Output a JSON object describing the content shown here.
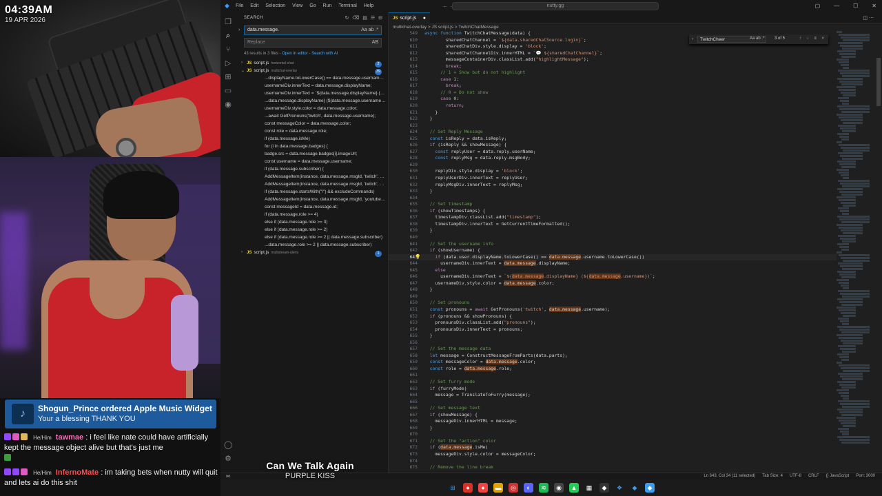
{
  "overlay": {
    "clock_time": "04:39AM",
    "clock_date": "19 APR 2026",
    "alert": {
      "title": "Shogun_Prince ordered Apple Music Widget",
      "subtitle": "Your a blessing THANK YOU"
    },
    "chat": [
      {
        "pronoun": "He/Him",
        "user": "tawmae",
        "text": ": i feel like nate could have artificially kept the message object alive but that's just me"
      },
      {
        "pronoun": "He/Him",
        "user": "InfernoMate",
        "text": ": im taking bets when nutty will quit and lets ai do this shit"
      }
    ],
    "now_playing": {
      "title": "Can We Talk Again",
      "artist": "PURPLE KISS"
    }
  },
  "vscode": {
    "menu": [
      "File",
      "Edit",
      "Selection",
      "View",
      "Go",
      "Run",
      "Terminal",
      "Help"
    ],
    "command_center": "nutty.gg",
    "sidebar": {
      "header": "SEARCH",
      "search_value": "data.message.",
      "search_opts": "Aa ab .*",
      "replace_placeholder": "Replace",
      "replace_opts": "AB",
      "results_count": "43 results in 3 files - ",
      "open_in_editor": "Open in editor",
      "search_ai": "Search with AI",
      "files": [
        {
          "name": "script.js",
          "path": "horizontal-chat",
          "count": "2"
        },
        {
          "name": "script.js",
          "path": "multichat-overlay",
          "count": "39"
        },
        {
          "name": "script.js",
          "path": "multistream-alerts",
          "count": "1"
        }
      ],
      "matches": [
        "...displayName.toLowerCase() == data.message.username.toLowerC...",
        "usernameDiv.innerText = data.message.displayName;",
        "usernameDiv.innerText = `${data.message.displayName} (${data.me...",
        "...data.message.displayName} (${data.message.username})`;",
        "usernameDiv.style.color = data.message.color;",
        "...await GetPronouns('twitch', data.message.username);",
        "const messageColor = data.message.color;",
        "const role = data.message.role;",
        "if (data.message.isMe)",
        "for (i in data.message.badges) {",
        "badge.src = data.message.badges[i].imageUrl;",
        "const username = data.message.username;",
        "if (data.message.subscriber) {",
        "AddMessageItem(instance, data.message.msgId, 'twitch', data.user.i...",
        "AddMessageItem(instance, data.message.msgId, 'twitch', data.user.i...",
        "if (data.message.startsWith(\"!\") && excludeCommands)",
        "AddMessageItem(instance, data.message.msgId, 'youtube', data.use...",
        "const messageId = data.message.id;",
        "if (data.message.role >= 4)",
        "else if (data.message.role >= 3)",
        "else if (data.message.role >= 2)",
        "else if (data.message.role >= 2 || data.message.subscriber)",
        "...data.message.role >= 2 || data.message.subscriber)"
      ]
    },
    "tab": {
      "name": "script.js"
    },
    "breadcrumb": "multichat-overlay > JS script.js > TwitchChatMessage",
    "find": {
      "value": "TwitchCheer",
      "opts": "Aa ab .*",
      "count": "3 of 5",
      "btns": "↑ ↓ ≡ ×"
    },
    "code": [
      {
        "n": "549",
        "t": "async function TwitchChatMessage(data) {"
      },
      {
        "n": "610",
        "t": "        sharedChatChannel = `${data.sharedChatSource.login}`;"
      },
      {
        "n": "611",
        "t": "        sharedChatDiv.style.display = 'block';"
      },
      {
        "n": "612",
        "t": "        sharedChatChannelDiv.innerHTML = `💬 ${sharedChatChannel}`;"
      },
      {
        "n": "613",
        "t": "        messageContainerDiv.classList.add(\"highlightMessage\");"
      },
      {
        "n": "614",
        "t": "        break;"
      },
      {
        "n": "615",
        "t": "      // 1 = Show but do not highlight"
      },
      {
        "n": "616",
        "t": "      case 1:"
      },
      {
        "n": "617",
        "t": "        break;"
      },
      {
        "n": "618",
        "t": "      // 0 = Do not show"
      },
      {
        "n": "619",
        "t": "      case 0:"
      },
      {
        "n": "620",
        "t": "        return;"
      },
      {
        "n": "621",
        "t": "    }"
      },
      {
        "n": "622",
        "t": "  }"
      },
      {
        "n": "623",
        "t": ""
      },
      {
        "n": "624",
        "t": "  // Set Reply Message"
      },
      {
        "n": "625",
        "t": "  const isReply = data.isReply;"
      },
      {
        "n": "626",
        "t": "  if (isReply && showMessage) {"
      },
      {
        "n": "627",
        "t": "    const replyUser = data.reply.userName;"
      },
      {
        "n": "628",
        "t": "    const replyMsg = data.reply.msgBody;"
      },
      {
        "n": "629",
        "t": ""
      },
      {
        "n": "630",
        "t": "    replyDiv.style.display = 'block';"
      },
      {
        "n": "631",
        "t": "    replyUserDiv.innerText = replyUser;"
      },
      {
        "n": "632",
        "t": "    replyMsgDiv.innerText = replyMsg;"
      },
      {
        "n": "633",
        "t": "  }"
      },
      {
        "n": "634",
        "t": ""
      },
      {
        "n": "635",
        "t": "  // Set timestamp"
      },
      {
        "n": "636",
        "t": "  if (showTimestamps) {"
      },
      {
        "n": "637",
        "t": "    timestampDiv.classList.add(\"timestamp\");"
      },
      {
        "n": "638",
        "t": "    timestampDiv.innerText = GetCurrentTimeFormatted();"
      },
      {
        "n": "639",
        "t": "  }"
      },
      {
        "n": "640",
        "t": ""
      },
      {
        "n": "641",
        "t": "  // Set the username info"
      },
      {
        "n": "642",
        "t": "  if (showUsername) {"
      },
      {
        "n": "643",
        "t": "    if (data.user.displayName.toLowerCase() == data.message.username.toLowerCase())"
      },
      {
        "n": "644",
        "t": "      usernameDiv.innerText = data.message.displayName;"
      },
      {
        "n": "645",
        "t": "    else"
      },
      {
        "n": "646",
        "t": "      usernameDiv.innerText = `${data.message.displayName} (${data.message.username})`;"
      },
      {
        "n": "647",
        "t": "    usernameDiv.style.color = data.message.color;"
      },
      {
        "n": "648",
        "t": "  }"
      },
      {
        "n": "649",
        "t": ""
      },
      {
        "n": "650",
        "t": "  // Set pronouns"
      },
      {
        "n": "651",
        "t": "  const pronouns = await GetPronouns('twitch', data.message.username);"
      },
      {
        "n": "652",
        "t": "  if (pronouns && showPronouns) {"
      },
      {
        "n": "653",
        "t": "    pronounsDiv.classList.add(\"pronouns\");"
      },
      {
        "n": "654",
        "t": "    pronounsDiv.innerText = pronouns;"
      },
      {
        "n": "655",
        "t": "  }"
      },
      {
        "n": "656",
        "t": ""
      },
      {
        "n": "657",
        "t": "  // Set the message data"
      },
      {
        "n": "658",
        "t": "  let message = ConstructMessageFromParts(data.parts);"
      },
      {
        "n": "659",
        "t": "  const messageColor = data.message.color;"
      },
      {
        "n": "660",
        "t": "  const role = data.message.role;"
      },
      {
        "n": "661",
        "t": ""
      },
      {
        "n": "662",
        "t": "  // Set furry mode"
      },
      {
        "n": "663",
        "t": "  if (furryMode)"
      },
      {
        "n": "664",
        "t": "    message = TranslateToFurry(message);"
      },
      {
        "n": "665",
        "t": ""
      },
      {
        "n": "666",
        "t": "  // Set message text"
      },
      {
        "n": "667",
        "t": "  if (showMessage) {"
      },
      {
        "n": "668",
        "t": "    messageDiv.innerHTML = message;"
      },
      {
        "n": "669",
        "t": "  }"
      },
      {
        "n": "670",
        "t": ""
      },
      {
        "n": "671",
        "t": "  // Set the \"action\" color"
      },
      {
        "n": "672",
        "t": "  if (data.message.isMe)"
      },
      {
        "n": "673",
        "t": "    messageDiv.style.color = messageColor;"
      },
      {
        "n": "674",
        "t": ""
      },
      {
        "n": "675",
        "t": "  // Remove the line break"
      },
      {
        "n": "676",
        "t": "  if (isLineChat) {"
      }
    ],
    "active_line": "643",
    "status": {
      "position": "Ln 643, Col 34 (11 selected)",
      "tab_size": "Tab Size: 4",
      "encoding": "UTF-8",
      "eol": "CRLF",
      "language": "{} JavaScript",
      "port": "Port: 3000"
    }
  },
  "colors": {
    "alert_bg": "#1e5b9c",
    "editor_bg": "#1f1f1f",
    "accent": "#0e639c",
    "jersey": "#c8222b"
  }
}
